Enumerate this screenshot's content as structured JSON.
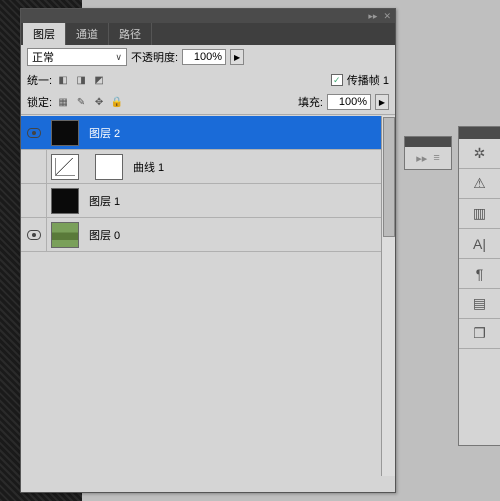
{
  "panel": {
    "tabs": [
      "图层",
      "通道",
      "路径"
    ],
    "activeTab": 0,
    "blendMode": "正常",
    "opacityLabel": "不透明度:",
    "opacityValue": "100%",
    "unifyLabel": "统一:",
    "propagateLabel": "传播帧 1",
    "propagateChecked": true,
    "lockLabel": "锁定:",
    "fillLabel": "填充:",
    "fillValue": "100%"
  },
  "layers": [
    {
      "visible": true,
      "name": "图层 2",
      "thumb": "dark",
      "selected": true
    },
    {
      "visible": false,
      "name": "曲线 1",
      "thumb": "curve",
      "hasMask": true,
      "selected": false
    },
    {
      "visible": false,
      "name": "图层 1",
      "thumb": "dark",
      "selected": false
    },
    {
      "visible": true,
      "name": "图层 0",
      "thumb": "photo",
      "selected": false
    }
  ],
  "dock": {
    "items": [
      "gear",
      "warn",
      "histogram",
      "type",
      "paragraph",
      "swatches",
      "layers"
    ]
  }
}
